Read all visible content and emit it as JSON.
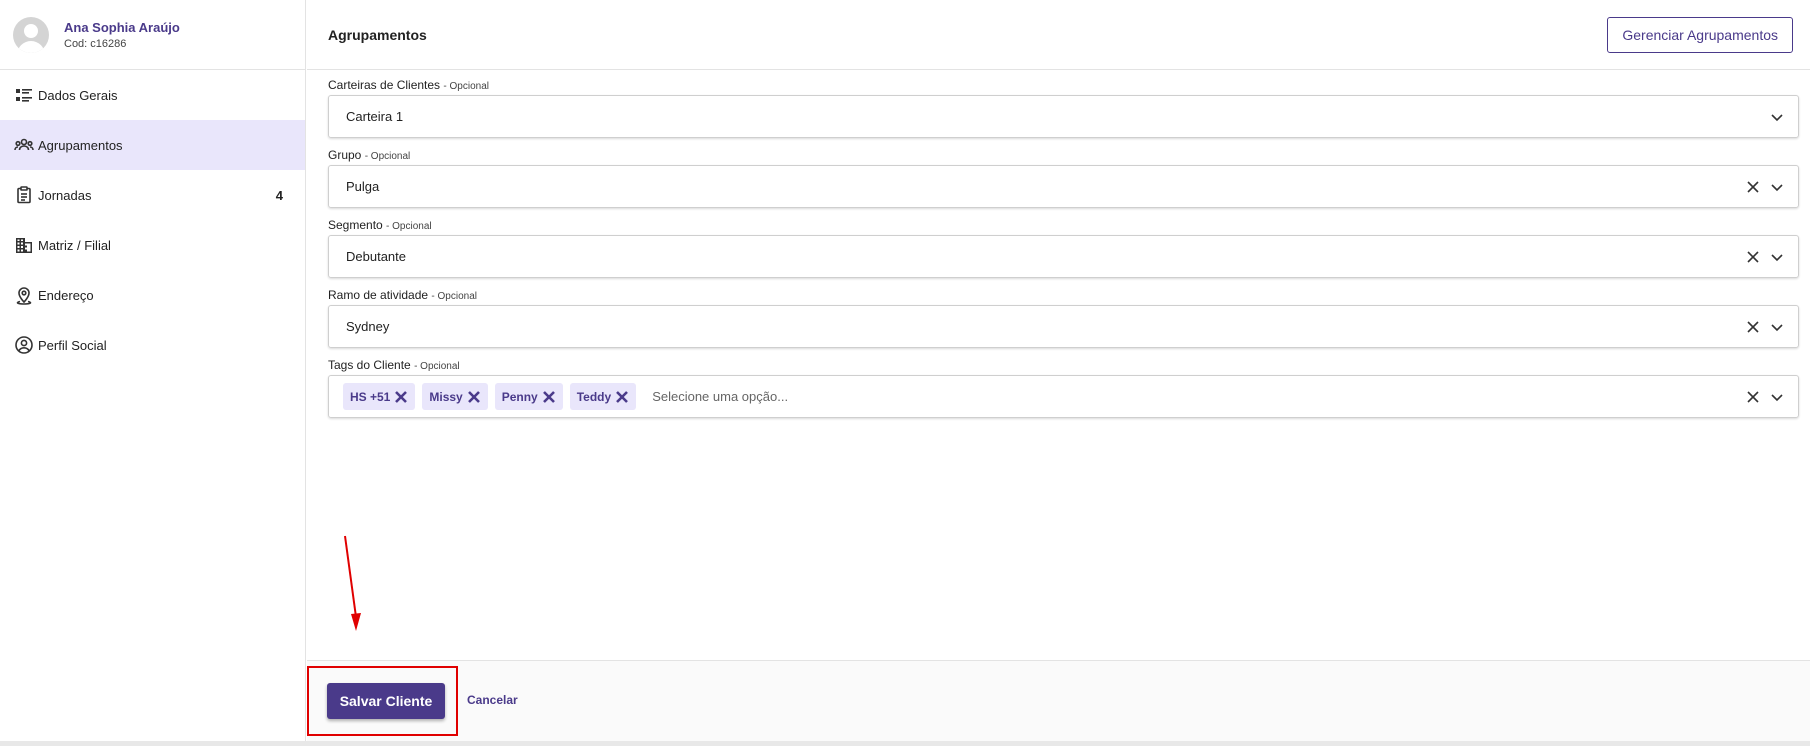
{
  "profile": {
    "name": "Ana Sophia Araújo",
    "code": "Cod: c16286"
  },
  "sidebar": {
    "items": [
      {
        "label": "Dados Gerais",
        "icon": "list-details-icon"
      },
      {
        "label": "Agrupamentos",
        "icon": "users-group-icon",
        "active": true
      },
      {
        "label": "Jornadas",
        "icon": "clipboard-icon",
        "badge": "4"
      },
      {
        "label": "Matriz / Filial",
        "icon": "building-icon"
      },
      {
        "label": "Endereço",
        "icon": "map-pin-icon"
      },
      {
        "label": "Perfil Social",
        "icon": "user-circle-icon"
      }
    ]
  },
  "header": {
    "title": "Agrupamentos",
    "manage_button": "Gerenciar Agrupamentos"
  },
  "form": {
    "optional_text": "- Opcional",
    "fields": [
      {
        "label": "Carteiras de Clientes",
        "value": "Carteira 1"
      },
      {
        "label": "Grupo",
        "value": "Pulga"
      },
      {
        "label": "Segmento",
        "value": "Debutante"
      },
      {
        "label": "Ramo de atividade",
        "value": "Sydney"
      },
      {
        "label": "Tags do Cliente",
        "placeholder": "Selecione uma opção..."
      }
    ],
    "tags": [
      "HS +51",
      "Missy",
      "Penny",
      "Teddy"
    ]
  },
  "footer": {
    "save_button": "Salvar Cliente",
    "cancel_link": "Cancelar"
  },
  "colors": {
    "accent": "#4a3a8a",
    "active_bg": "#e9e6fb",
    "annotation": "#e00000"
  }
}
